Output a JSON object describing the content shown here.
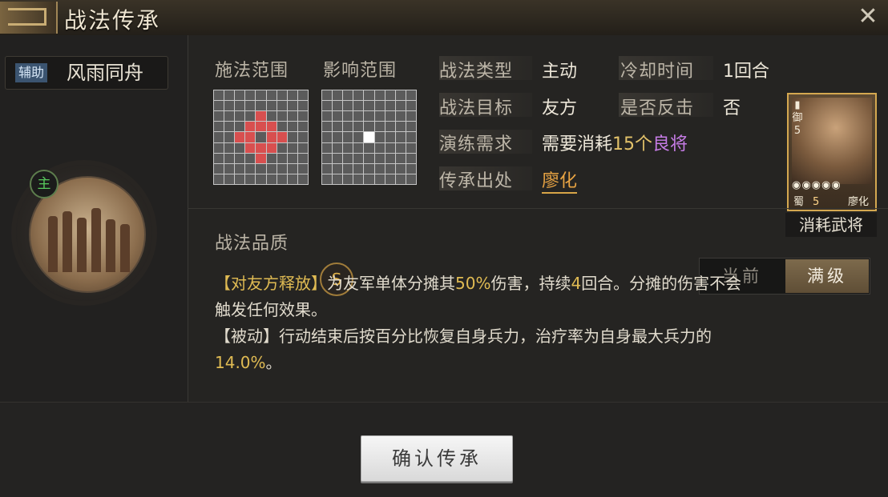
{
  "titlebar": {
    "title": "战法传承",
    "close": "✕"
  },
  "skill": {
    "type_badge": "辅助",
    "name": "风雨同舟"
  },
  "main_badge": "主",
  "range": {
    "cast_label": "施法范围",
    "effect_label": "影响范围"
  },
  "info": {
    "type_label": "战法类型",
    "type_value": "主动",
    "cooldown_label": "冷却时间",
    "cooldown_value": "1回合",
    "target_label": "战法目标",
    "target_value": "友方",
    "counter_label": "是否反击",
    "counter_value": "否",
    "drill_label": "演练需求",
    "drill_value_prefix": "需要消耗",
    "drill_value_count": "15个",
    "drill_value_item": "良将",
    "origin_label": "传承出处",
    "origin_value": "廖化"
  },
  "general_card": {
    "level_char": "御",
    "level_num": "5",
    "stars": "◉◉◉◉◉",
    "faction": "蜀",
    "cost": "5",
    "name": "廖化",
    "label": "消耗武将"
  },
  "quality": {
    "label": "战法品质",
    "grade": "S"
  },
  "toggle": {
    "current": "当前",
    "full": "满级"
  },
  "description": {
    "line1_tag": "【对友方释放】",
    "line1_a": "为友军单体分摊其",
    "line1_pct": "50%",
    "line1_b": "伤害，持续",
    "line1_num": "4",
    "line1_c": "回合。分摊的伤害不会",
    "line2": "触发任何效果。",
    "line3_tag": "【被动】",
    "line3_text": "行动结束后按百分比恢复自身兵力，治疗率为自身最大兵力的",
    "line4_pct": "14.0%",
    "line4_tail": "。"
  },
  "actions": {
    "confirm": "确认传承"
  },
  "colors": {
    "accent_gold": "#e0bb53",
    "purple": "#c67ce6",
    "red_cells": "#d84f4f"
  }
}
